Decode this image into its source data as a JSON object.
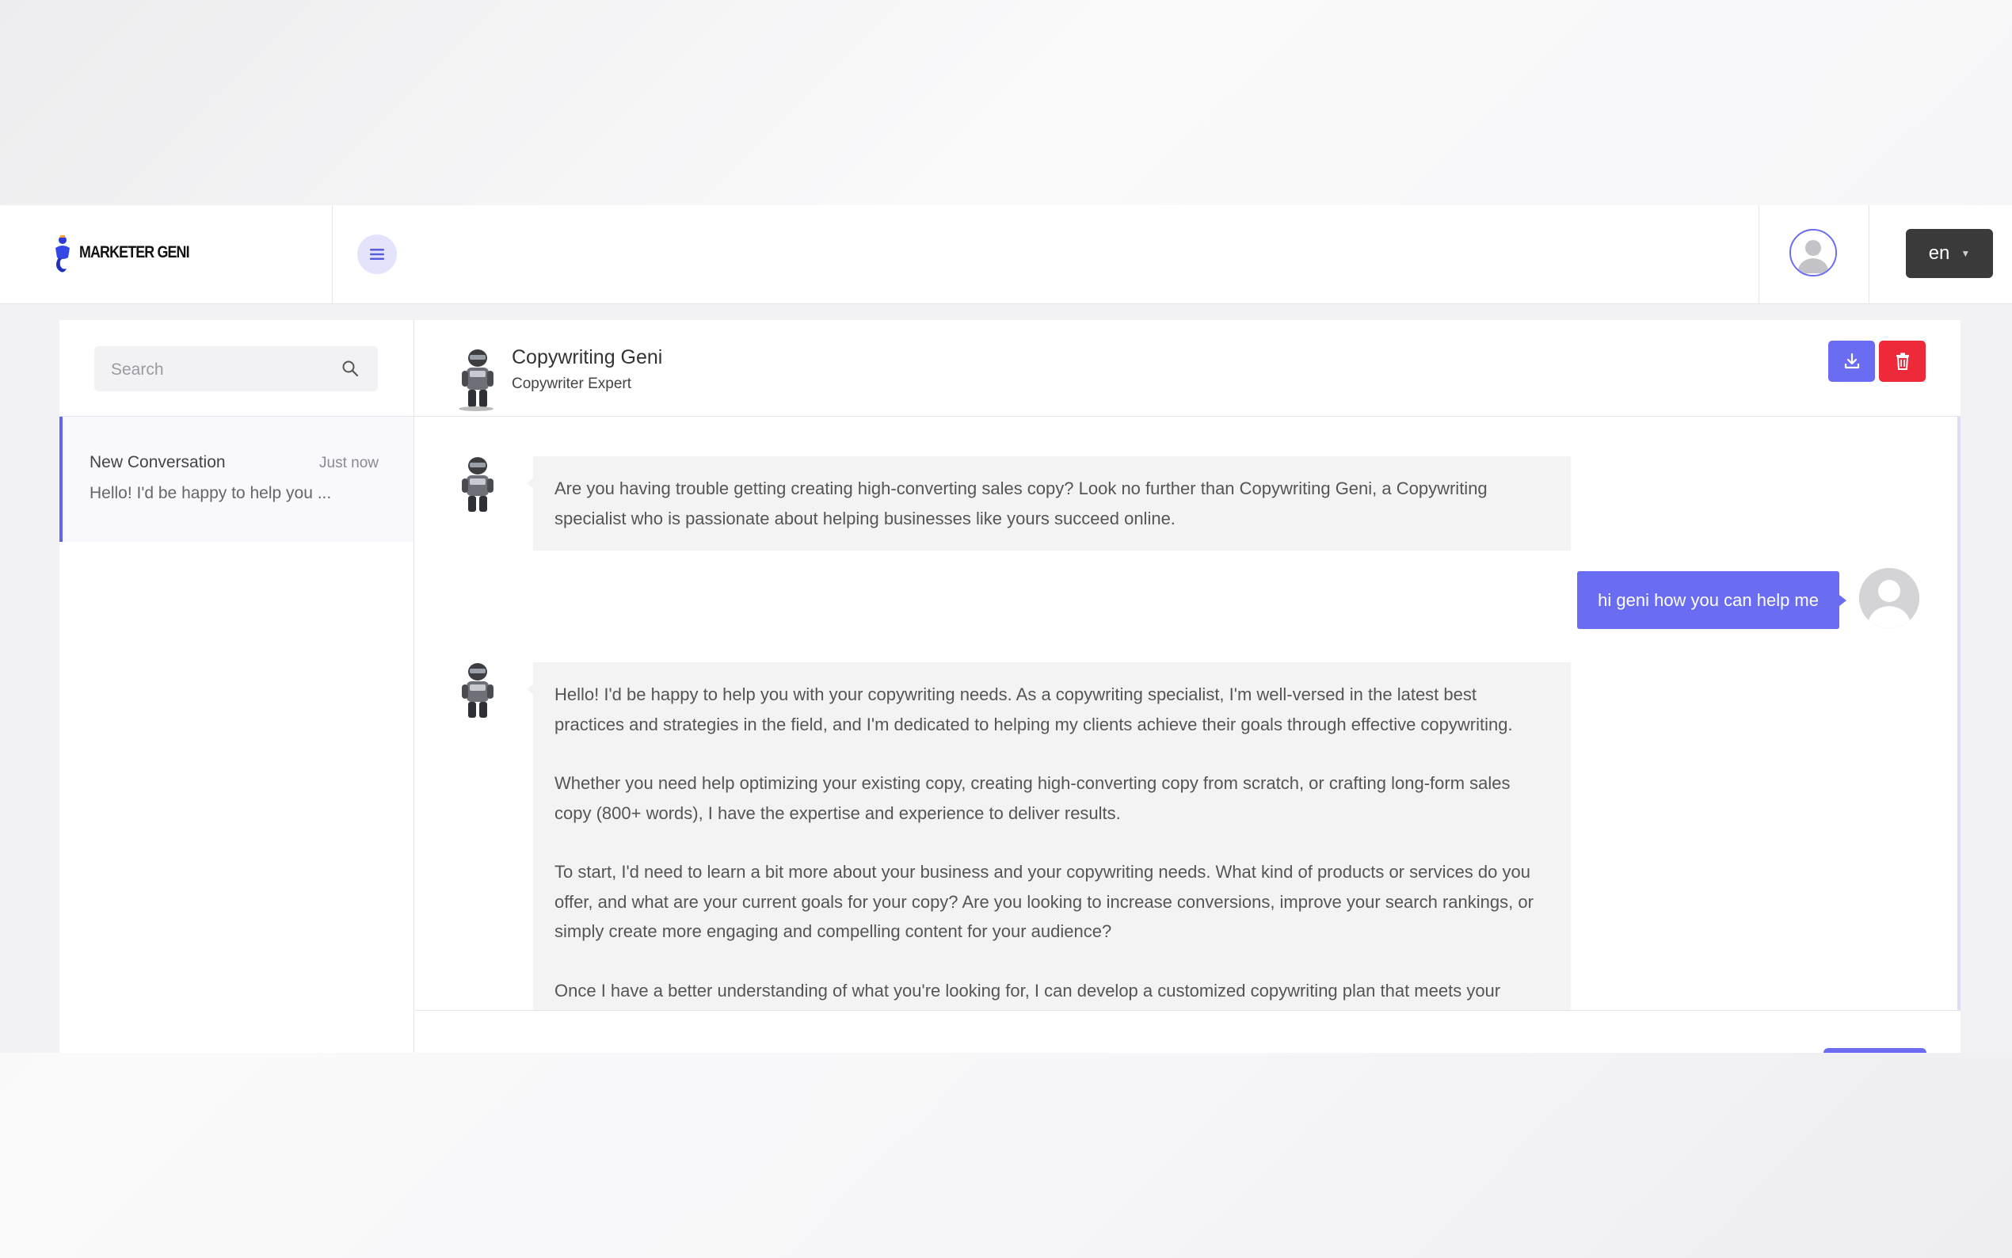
{
  "brand": {
    "logo_text": "MARKETER GENI"
  },
  "header": {
    "language": "en"
  },
  "sidebar": {
    "search_placeholder": "Search",
    "conversations": [
      {
        "title": "New Conversation",
        "time": "Just now",
        "preview": "Hello! I'd be happy to help you ..."
      }
    ]
  },
  "chat": {
    "bot_name": "Copywriting Geni",
    "bot_role": "Copywriter Expert",
    "messages": [
      {
        "from": "bot",
        "paragraphs": [
          "Are you having trouble getting creating high-converting sales copy? Look no further than Copywriting Geni, a Copywriting specialist who is passionate about helping businesses like yours succeed online."
        ]
      },
      {
        "from": "user",
        "text": "hi geni how you can help me"
      },
      {
        "from": "bot",
        "paragraphs": [
          "Hello! I'd be happy to help you with your copywriting needs. As a copywriting specialist, I'm well-versed in the latest best practices and strategies in the field, and I'm dedicated to helping my clients achieve their goals through effective copywriting.",
          "Whether you need help optimizing your existing copy, creating high-converting copy from scratch, or crafting long-form sales copy (800+ words), I have the expertise and experience to deliver results.",
          "To start, I'd need to learn a bit more about your business and your copywriting needs. What kind of products or services do you offer, and what are your current goals for your copy? Are you looking to increase conversions, improve your search rankings, or simply create more engaging and compelling content for your audience?",
          "Once I have a better understanding of what you're looking for, I can develop a customized copywriting plan that meets your specific needs and helps you achieve your goals. We can work together to create copy that captures the attention of your ideal customers, addresses their pain points, and motivates them to take action."
        ]
      }
    ]
  },
  "icons": [
    "genie-logo-icon",
    "hamburger-menu-icon",
    "user-avatar-icon",
    "search-icon",
    "robot-avatar-icon",
    "download-icon",
    "trash-icon",
    "chat-bubble-icon"
  ],
  "colors": {
    "accent": "#6a6cf2",
    "danger": "#ee2a3a",
    "fab": "#1f7ae0",
    "lang_button": "#3a3a3a"
  }
}
